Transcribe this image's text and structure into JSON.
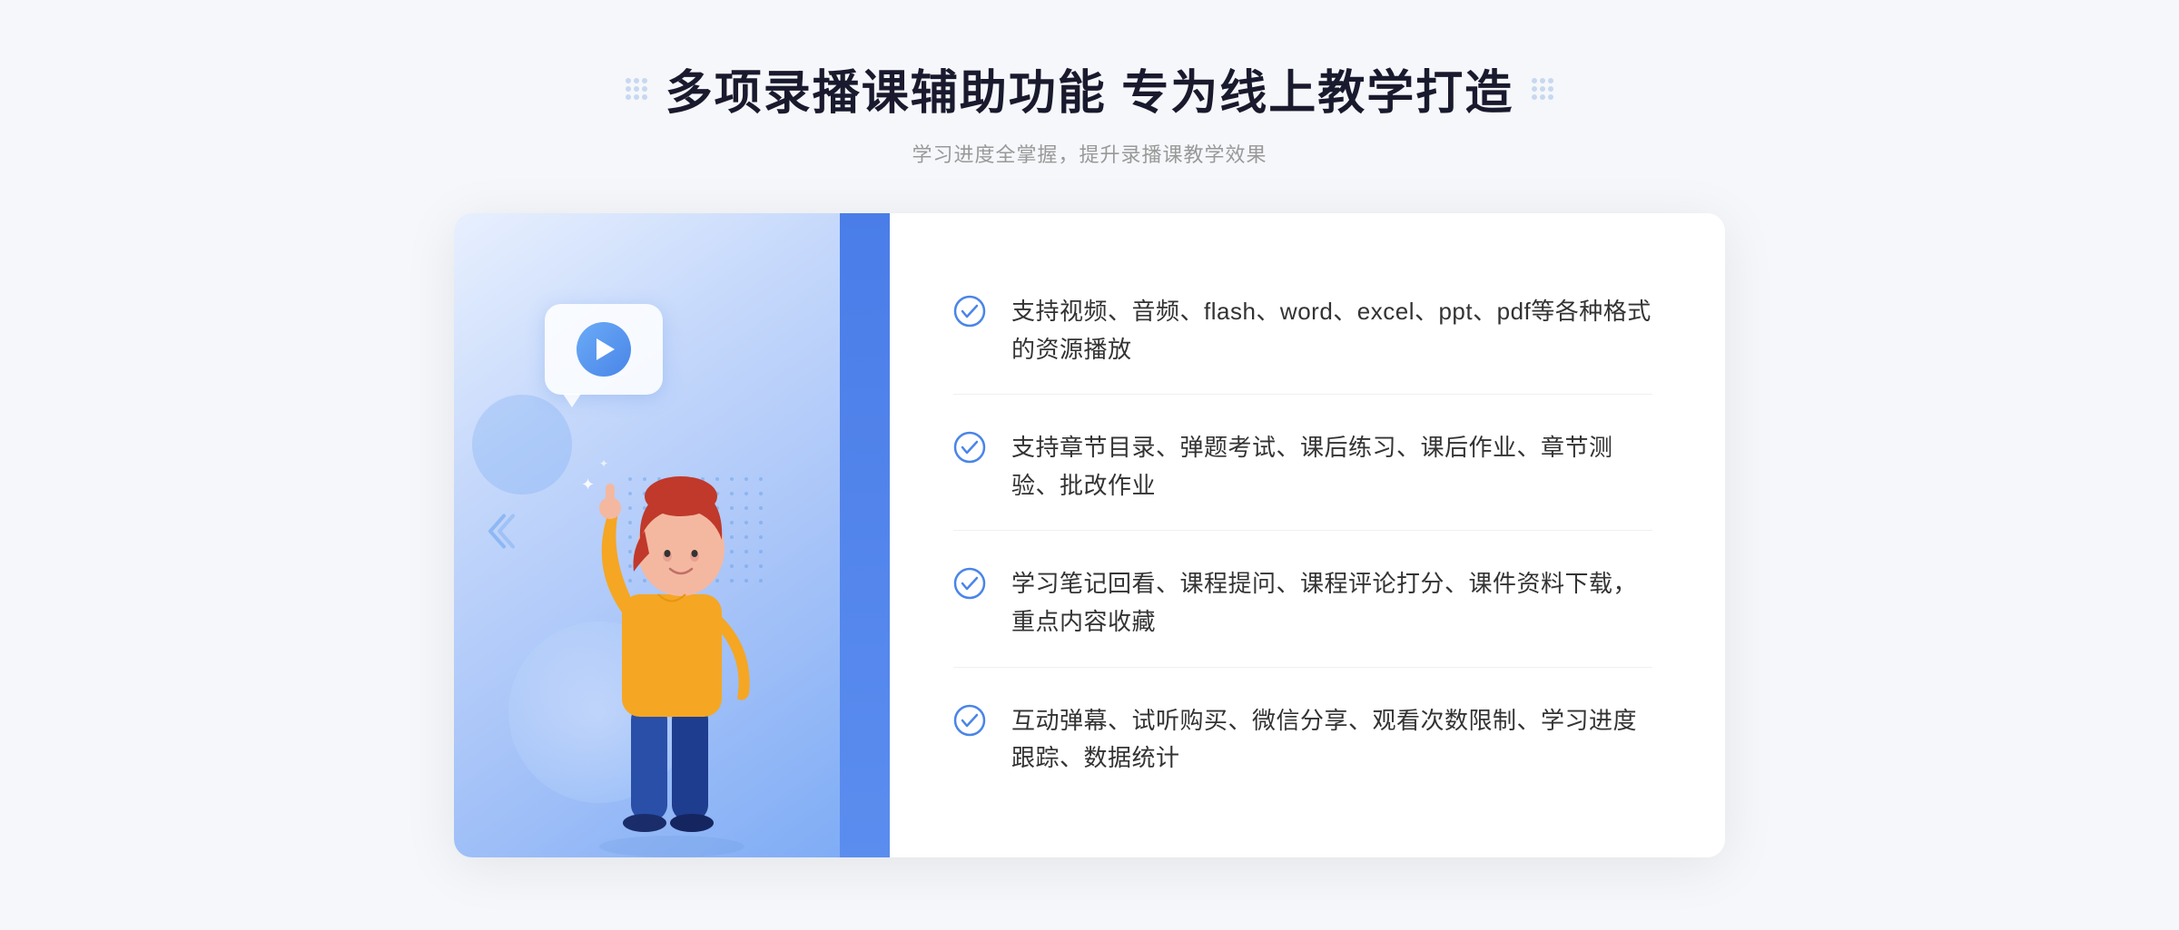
{
  "header": {
    "title": "多项录播课辅助功能 专为线上教学打造",
    "subtitle": "学习进度全掌握，提升录播课教学效果"
  },
  "features": [
    {
      "id": "feature-1",
      "text": "支持视频、音频、flash、word、excel、ppt、pdf等各种格式的资源播放"
    },
    {
      "id": "feature-2",
      "text": "支持章节目录、弹题考试、课后练习、课后作业、章节测验、批改作业"
    },
    {
      "id": "feature-3",
      "text": "学习笔记回看、课程提问、课程评论打分、课件资料下载，重点内容收藏"
    },
    {
      "id": "feature-4",
      "text": "互动弹幕、试听购买、微信分享、观看次数限制、学习进度跟踪、数据统计"
    }
  ],
  "icons": {
    "check": "check-circle-icon",
    "play": "play-icon",
    "chevrons": "chevrons-icon"
  },
  "colors": {
    "accent_blue": "#4a85e8",
    "light_blue": "#7baaf5",
    "bg_gradient_start": "#e8f0fe",
    "check_color": "#4a85e8"
  }
}
